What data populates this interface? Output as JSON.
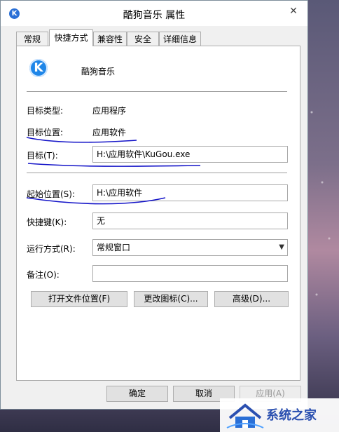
{
  "window": {
    "title": "酷狗音乐 属性",
    "app_icon_letter": "K",
    "close_glyph": "✕"
  },
  "tabs": [
    {
      "label": "常规"
    },
    {
      "label": "快捷方式",
      "active": true
    },
    {
      "label": "兼容性"
    },
    {
      "label": "安全"
    },
    {
      "label": "详细信息"
    }
  ],
  "shortcut": {
    "name": "酷狗音乐",
    "icon_letter": "K",
    "target_type_label": "目标类型:",
    "target_type_value": "应用程序",
    "target_location_label": "目标位置:",
    "target_location_value": "应用软件",
    "target_label": "目标(T):",
    "target_value": "H:\\应用软件\\KuGou.exe",
    "start_in_label": "起始位置(S):",
    "start_in_value": "H:\\应用软件",
    "shortcut_key_label": "快捷键(K):",
    "shortcut_key_value": "无",
    "run_label": "运行方式(R):",
    "run_value": "常规窗口",
    "comment_label": "备注(O):",
    "comment_value": ""
  },
  "buttons": {
    "open_location": "打开文件位置(F)",
    "change_icon": "更改图标(C)...",
    "advanced": "高级(D)...",
    "ok": "确定",
    "cancel": "取消",
    "apply": "应用(A)"
  },
  "watermark": {
    "text": "系统之家"
  },
  "colors": {
    "annotation_ink": "#1414c8",
    "icon_blue": "#1f86e8"
  }
}
